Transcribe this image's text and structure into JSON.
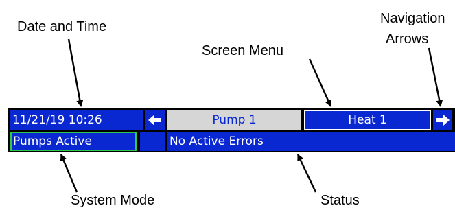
{
  "callouts": {
    "date_time": "Date and Time",
    "screen_menu": "Screen Menu",
    "navigation_line1": "Navigation",
    "navigation_line2": "Arrows",
    "system_mode": "System Mode",
    "status": "Status"
  },
  "hmi": {
    "datetime": "11/21/19 10:26",
    "nav_left_icon": "left-arrow-icon",
    "nav_right_icon": "right-arrow-icon",
    "tabs": [
      {
        "label": "Pump 1",
        "selected": false
      },
      {
        "label": "Heat 1",
        "selected": true
      }
    ],
    "system_mode": "Pumps Active",
    "status_text": "No Active Errors",
    "colors": {
      "screen_blue": "#0a28d2",
      "unselected_tab": "#d6d6d6",
      "mode_border": "#2ec84a",
      "background": "#000000"
    }
  }
}
